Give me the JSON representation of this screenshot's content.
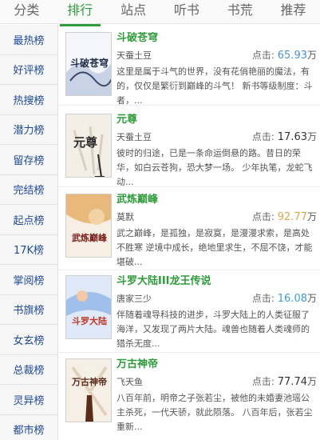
{
  "tabs": [
    {
      "label": "分类",
      "active": false
    },
    {
      "label": "排行",
      "active": true
    },
    {
      "label": "站点",
      "active": false
    },
    {
      "label": "听书",
      "active": false
    },
    {
      "label": "书荒",
      "active": false
    },
    {
      "label": "推荐",
      "active": false
    }
  ],
  "sidebar": {
    "items": [
      "最热榜",
      "好评榜",
      "热搜榜",
      "潜力榜",
      "留存榜",
      "完结榜",
      "起点榜",
      "17K榜",
      "掌阅榜",
      "书旗榜",
      "女玄榜",
      "总裁榜",
      "灵异榜",
      "都市榜"
    ]
  },
  "click_label": "点击:",
  "books": [
    {
      "title": "斗破苍穹",
      "author": "天蚕土豆",
      "clicks": "65.93",
      "unit": "万",
      "clicks_color": "#4a90d9",
      "desc": "这里是属于斗气的世界，没有花俏艳丽的魔法，有的，仅仅是繁衍到巅峰的斗气！ 新书等级制度：斗者，...",
      "cover_text": "斗破苍穹",
      "cover_colors": [
        "#f4f6fb",
        "#c9d3e6",
        "#3b4a6b"
      ]
    },
    {
      "title": "元尊",
      "author": "天蚕土豆",
      "clicks": "17.63",
      "unit": "万",
      "clicks_color": "#333333",
      "desc": "彼时的归途，已是一条命运倒悬的路。昔日的荣华，如白云苍狗，恐大梦一场。 少年执笔，龙蛇飞动...",
      "cover_text": "元尊",
      "cover_colors": [
        "#f3eee6",
        "#d8cfc0",
        "#2a2a2a"
      ]
    },
    {
      "title": "武炼巅峰",
      "author": "莫默",
      "clicks": "92.77",
      "unit": "万",
      "clicks_color": "#e0a84a",
      "desc": "武之巅峰，是孤独，是寂寞，是漫漫求索，是高处不胜寒 逆境中成长，绝地里求生，不屈不饶，才能堪破...",
      "cover_text": "武炼巅峰",
      "cover_colors": [
        "#f7efe3",
        "#e8b97a",
        "#7a1c1c"
      ]
    },
    {
      "title": "斗罗大陆III龙王传说",
      "author": "唐家三少",
      "clicks": "16.08",
      "unit": "万",
      "clicks_color": "#3aa0d8",
      "desc": "伴随着魂导科技的进步，斗罗大陆上的人类征服了海洋，又发现了两片大陆。魂兽也随着人类魂师的猎杀无度...",
      "cover_text": "斗罗大陆",
      "cover_colors": [
        "#dfe9f7",
        "#9ec0ea",
        "#c0392b"
      ]
    },
    {
      "title": "万古神帝",
      "author": "飞天鱼",
      "clicks": "77.74",
      "unit": "万",
      "clicks_color": "#333333",
      "desc": "八百年前，明帝之子张若尘，被他的未婚妻池瑶公主杀死，一代天骄，就此陨落。 八百年后，张若尘重新...",
      "cover_text": "万古神帝",
      "cover_colors": [
        "#f5efe6",
        "#e2d2bb",
        "#5a2c1a"
      ]
    }
  ]
}
